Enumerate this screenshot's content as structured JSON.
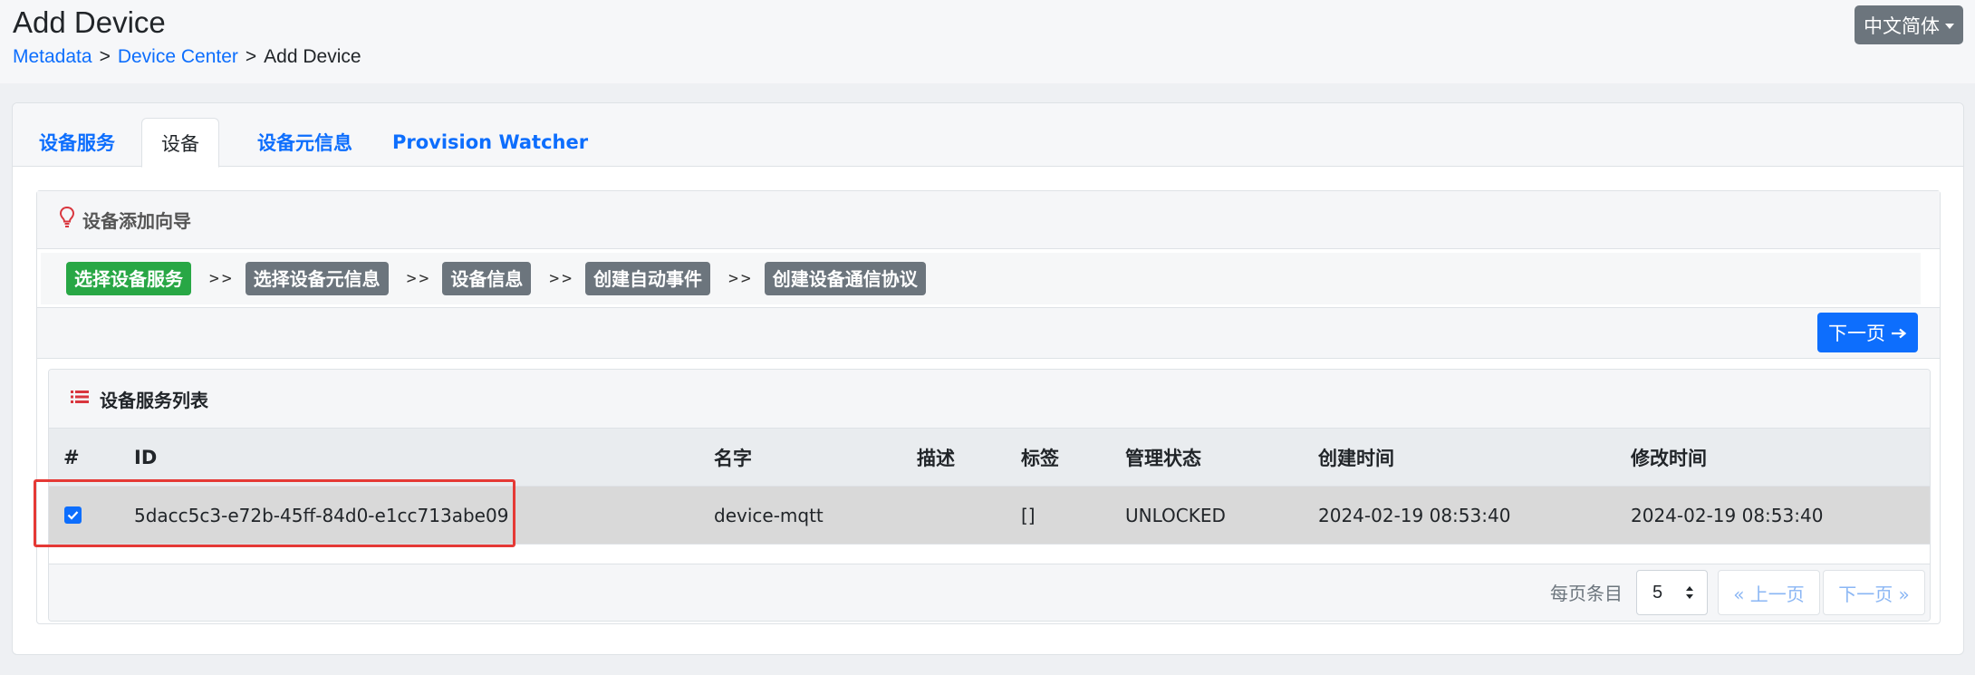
{
  "page": {
    "title": "Add Device",
    "breadcrumb": [
      "Metadata",
      "Device Center",
      "Add Device"
    ],
    "breadcrumb_sep": ">"
  },
  "language_button": {
    "label": "中文简体"
  },
  "tabs": [
    {
      "label": "设备服务",
      "active": false
    },
    {
      "label": "设备",
      "active": true
    },
    {
      "label": "设备元信息",
      "active": false
    },
    {
      "label": "Provision Watcher",
      "active": false
    }
  ],
  "wizard": {
    "title": "设备添加向导",
    "steps": [
      {
        "label": "选择设备服务",
        "current": true
      },
      {
        "label": "选择设备元信息",
        "current": false
      },
      {
        "label": "设备信息",
        "current": false
      },
      {
        "label": "创建自动事件",
        "current": false
      },
      {
        "label": "创建设备通信协议",
        "current": false
      }
    ],
    "step_sep": ">>",
    "next_label": "下一页"
  },
  "service_list": {
    "title": "设备服务列表",
    "columns": [
      "#",
      "ID",
      "名字",
      "描述",
      "标签",
      "管理状态",
      "创建时间",
      "修改时间"
    ],
    "rows": [
      {
        "checked": true,
        "id": "5dacc5c3-e72b-45ff-84d0-e1cc713abe09",
        "name": "device-mqtt",
        "description": "",
        "labels": "[]",
        "admin_state": "UNLOCKED",
        "created": "2024-02-19 08:53:40",
        "modified": "2024-02-19 08:53:40"
      }
    ],
    "footer": {
      "page_size_label": "每页条目",
      "page_size": "5",
      "prev_label": "« 上一页",
      "next_label": "下一页 »"
    }
  },
  "colors": {
    "primary": "#0d6efd",
    "success": "#28a745",
    "secondary": "#6c757d",
    "highlight": "#e53935"
  }
}
